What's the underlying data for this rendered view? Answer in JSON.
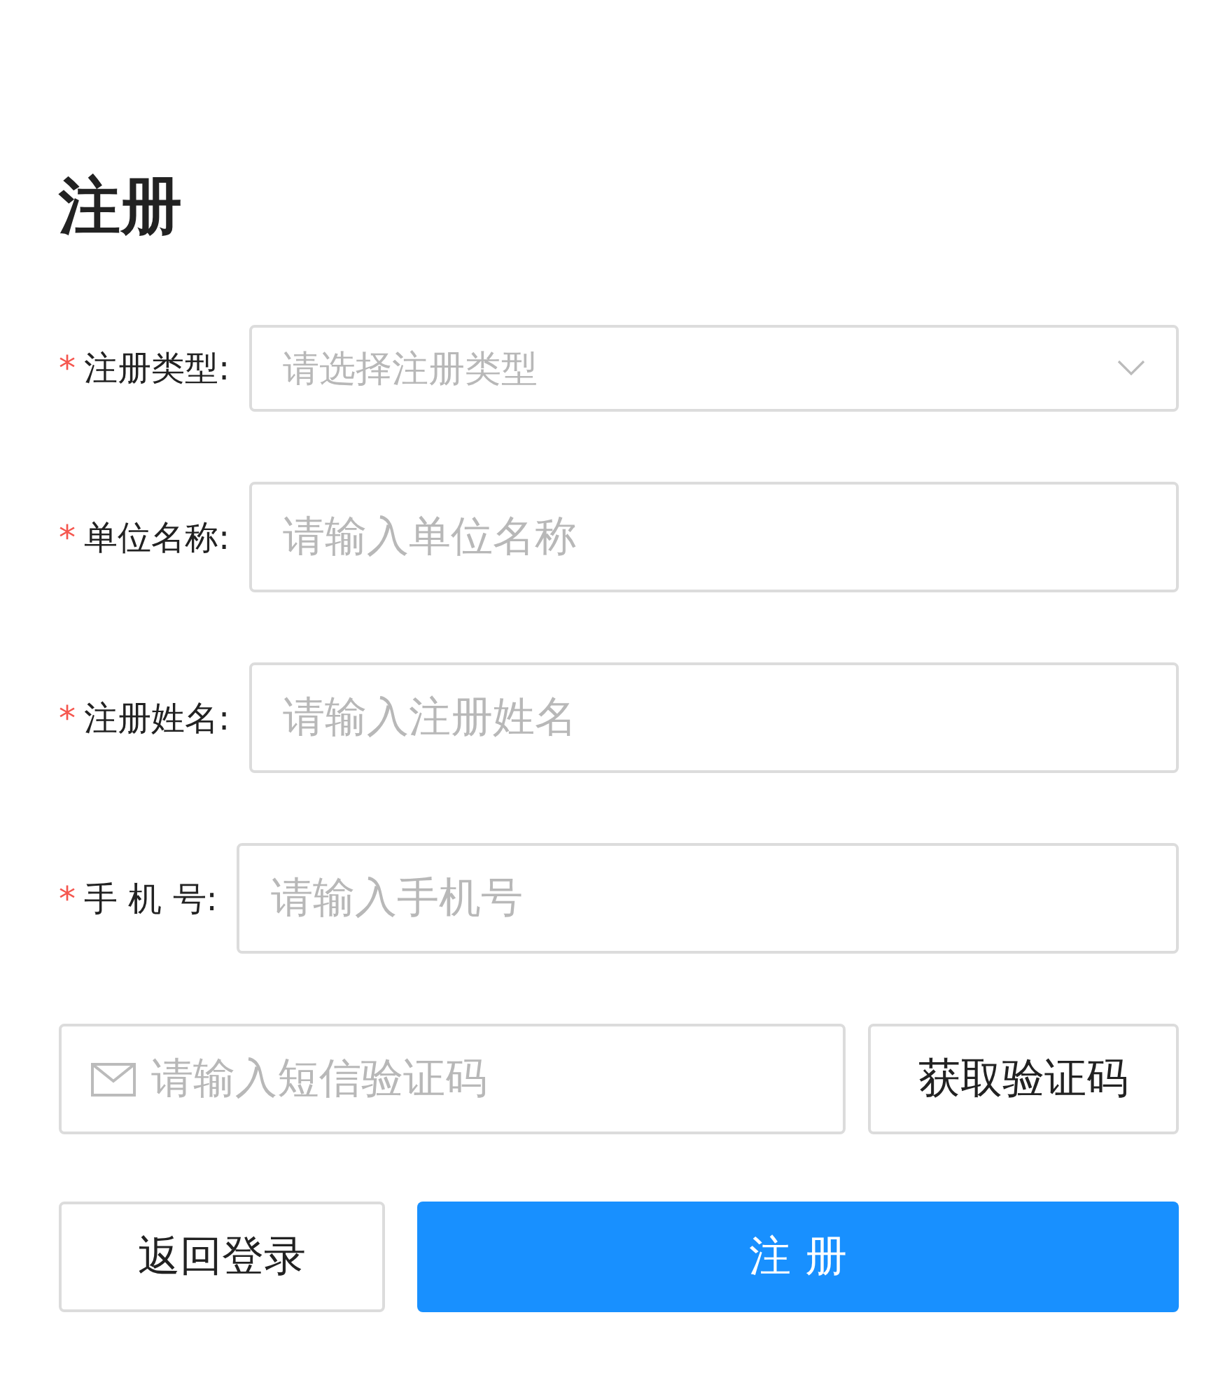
{
  "title": "注册",
  "fields": [
    {
      "kind": "select",
      "required_mark": "*",
      "label": "注册类型:",
      "placeholder": "请选择注册类型"
    },
    {
      "kind": "input",
      "required_mark": "*",
      "label": "单位名称:",
      "placeholder": "请输入单位名称"
    },
    {
      "kind": "input",
      "required_mark": "*",
      "label": "注册姓名:",
      "placeholder": "请输入注册姓名"
    },
    {
      "kind": "input",
      "required_mark": "*",
      "label": "手 机 号:",
      "placeholder": "请输入手机号"
    }
  ],
  "code": {
    "placeholder": "请输入短信验证码",
    "button": "获取验证码"
  },
  "buttons": [
    {
      "kind": "default",
      "label": "返回登录"
    },
    {
      "kind": "primary",
      "label": "注 册"
    }
  ]
}
